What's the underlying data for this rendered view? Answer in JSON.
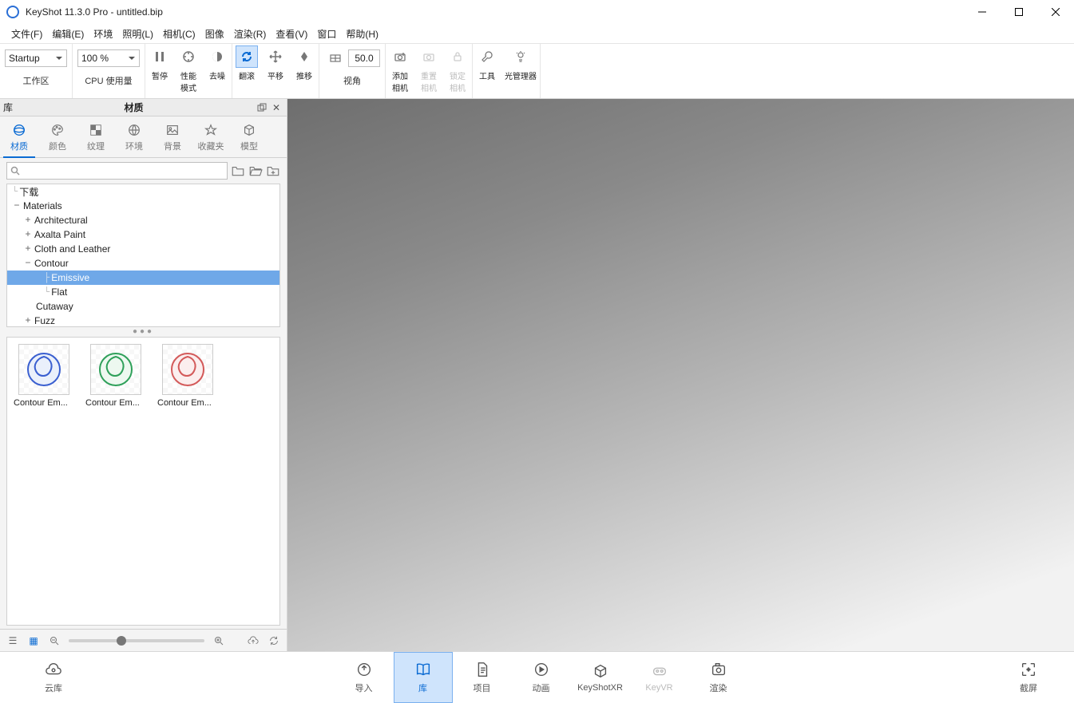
{
  "titlebar": {
    "title": "KeyShot 11.3.0 Pro  - untitled.bip"
  },
  "menu": [
    "文件(F)",
    "编辑(E)",
    "环境",
    "照明(L)",
    "相机(C)",
    "图像",
    "渲染(R)",
    "查看(V)",
    "窗口",
    "帮助(H)"
  ],
  "toolbar": {
    "workspace_combo": "Startup",
    "workspace_label": "工作区",
    "zoom_combo": "100 %",
    "cpu_label": "CPU 使用量",
    "pause": "暂停",
    "perf": "性能\n模式",
    "denoise": "去噪",
    "tumble": "翻滚",
    "pan": "平移",
    "dolly": "推移",
    "angle_value": "50.0",
    "angle_label": "视角",
    "add_cam": "添加\n相机",
    "reset_cam": "重置\n相机",
    "lock_cam": "锁定\n相机",
    "tools": "工具",
    "light_mgr": "光管理器"
  },
  "panel": {
    "left_label": "库",
    "title": "材质"
  },
  "libtabs": [
    {
      "id": "materials",
      "label": "材质"
    },
    {
      "id": "colors",
      "label": "颜色"
    },
    {
      "id": "textures",
      "label": "纹理"
    },
    {
      "id": "env",
      "label": "环境"
    },
    {
      "id": "backplates",
      "label": "背景"
    },
    {
      "id": "favorites",
      "label": "收藏夹"
    },
    {
      "id": "models",
      "label": "模型"
    }
  ],
  "tree": {
    "downloads": "下载",
    "materials": "Materials",
    "architectural": "Architectural",
    "axalta": "Axalta Paint",
    "cloth": "Cloth and Leather",
    "contour": "Contour",
    "emissive": "Emissive",
    "flat": "Flat",
    "cutaway": "Cutaway",
    "fuzz": "Fuzz"
  },
  "thumbs": [
    {
      "label": "Contour Em...",
      "color": "#3a5fd0"
    },
    {
      "label": "Contour Em...",
      "color": "#2fa05a"
    },
    {
      "label": "Contour Em...",
      "color": "#d35a5a"
    }
  ],
  "bottom": {
    "cloud": "云库",
    "import": "导入",
    "library": "库",
    "project": "项目",
    "animation": "动画",
    "keyshotxr": "KeyShotXR",
    "keyvr": "KeyVR",
    "render": "渲染",
    "screenshot": "截屏"
  }
}
